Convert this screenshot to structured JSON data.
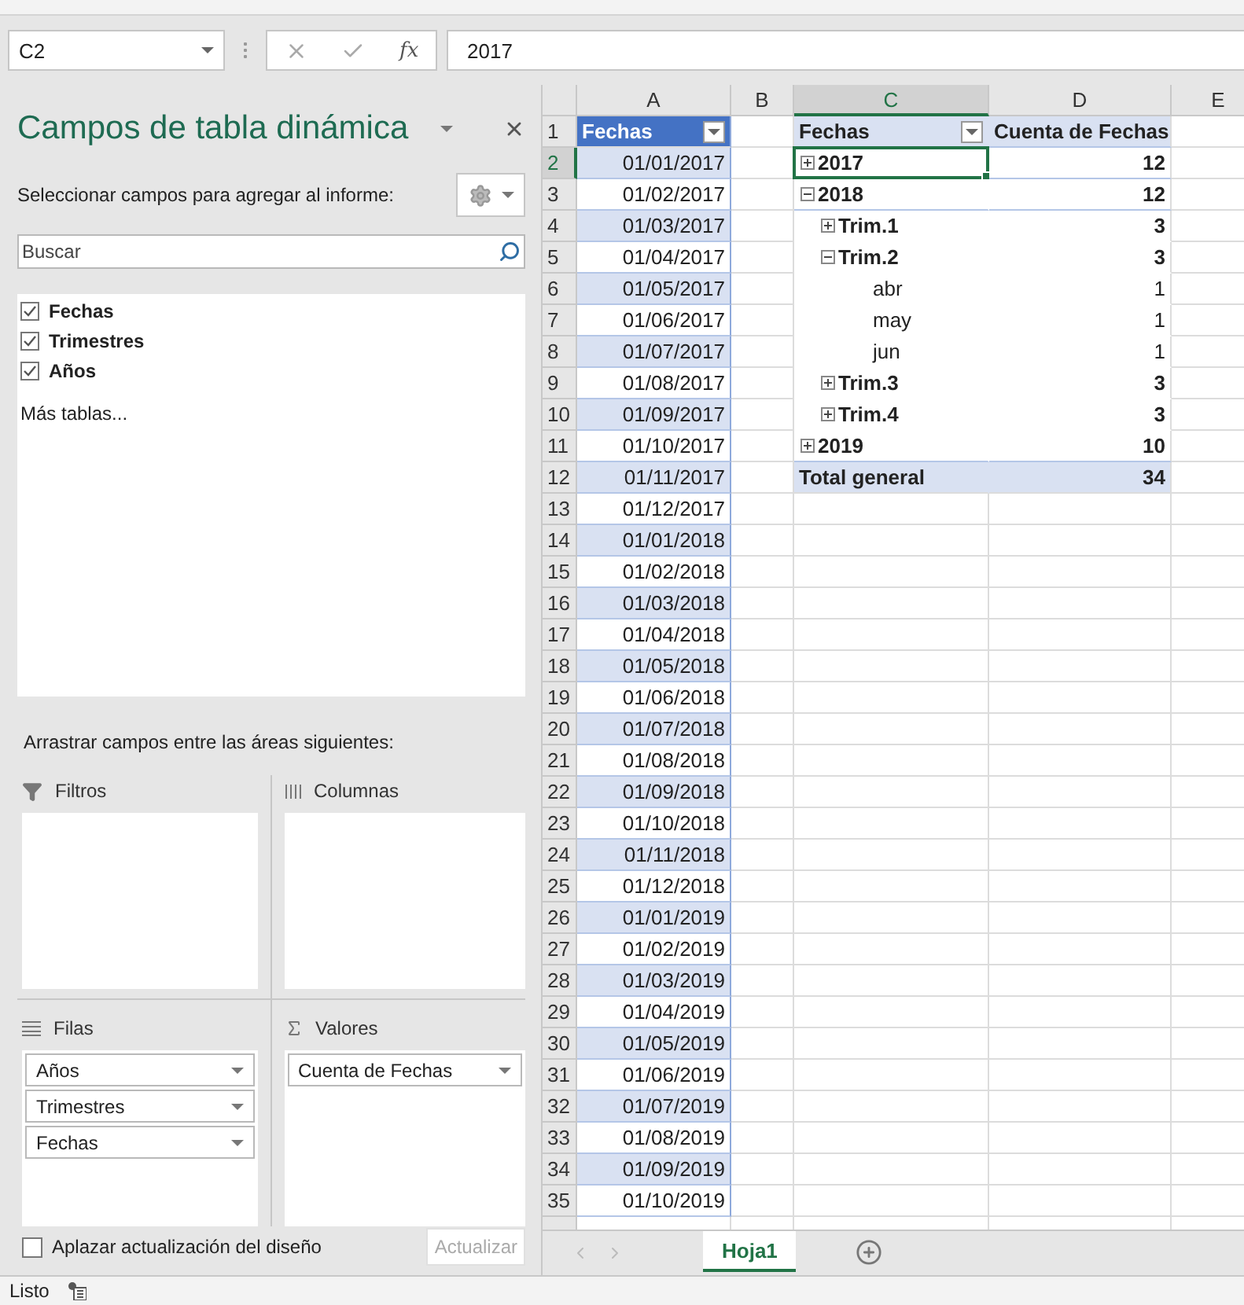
{
  "formula_bar": {
    "name_box": "C2",
    "function_label": "fx",
    "value": "2017"
  },
  "pivot_pane": {
    "title": "Campos de tabla dinámica",
    "subtitle": "Seleccionar campos para agregar al informe:",
    "search": {
      "placeholder": "Buscar"
    },
    "fields": [
      {
        "label": "Fechas",
        "checked": true
      },
      {
        "label": "Trimestres",
        "checked": true
      },
      {
        "label": "Años",
        "checked": true
      }
    ],
    "more_tables": "Más tablas...",
    "areas_label": "Arrastrar campos entre las áreas siguientes:",
    "areas": [
      {
        "name": "Filtros",
        "kind": "filter"
      },
      {
        "name": "Columnas",
        "kind": "columns"
      },
      {
        "name": "Filas",
        "kind": "rows",
        "items": [
          "Años",
          "Trimestres",
          "Fechas"
        ]
      },
      {
        "name": "Valores",
        "kind": "values",
        "items": [
          "Cuenta de Fechas"
        ]
      }
    ],
    "defer": {
      "label": "Aplazar actualización del diseño",
      "checked": false
    },
    "update_button": "Actualizar"
  },
  "sheet": {
    "columns": [
      {
        "label": "A",
        "selected": false
      },
      {
        "label": "B",
        "selected": false
      },
      {
        "label": "C",
        "selected": true
      },
      {
        "label": "D",
        "selected": false
      },
      {
        "label": "E",
        "selected": false
      }
    ],
    "row_numbers": [
      {
        "label": "1",
        "selected": false
      },
      {
        "label": "2",
        "selected": true
      },
      {
        "label": "3",
        "selected": false
      },
      {
        "label": "4",
        "selected": false
      },
      {
        "label": "5",
        "selected": false
      },
      {
        "label": "6",
        "selected": false
      },
      {
        "label": "7",
        "selected": false
      },
      {
        "label": "8",
        "selected": false
      },
      {
        "label": "9",
        "selected": false
      },
      {
        "label": "10",
        "selected": false
      },
      {
        "label": "11",
        "selected": false
      },
      {
        "label": "12",
        "selected": false
      },
      {
        "label": "13",
        "selected": false
      },
      {
        "label": "14",
        "selected": false
      },
      {
        "label": "15",
        "selected": false
      },
      {
        "label": "16",
        "selected": false
      },
      {
        "label": "17",
        "selected": false
      },
      {
        "label": "18",
        "selected": false
      },
      {
        "label": "19",
        "selected": false
      },
      {
        "label": "20",
        "selected": false
      },
      {
        "label": "21",
        "selected": false
      },
      {
        "label": "22",
        "selected": false
      },
      {
        "label": "23",
        "selected": false
      },
      {
        "label": "24",
        "selected": false
      },
      {
        "label": "25",
        "selected": false
      },
      {
        "label": "26",
        "selected": false
      },
      {
        "label": "27",
        "selected": false
      },
      {
        "label": "28",
        "selected": false
      },
      {
        "label": "29",
        "selected": false
      },
      {
        "label": "30",
        "selected": false
      },
      {
        "label": "31",
        "selected": false
      },
      {
        "label": "32",
        "selected": false
      },
      {
        "label": "33",
        "selected": false
      },
      {
        "label": "34",
        "selected": false
      },
      {
        "label": "35",
        "selected": false
      }
    ],
    "table": {
      "header": "Fechas",
      "dates": [
        "01/01/2017",
        "01/02/2017",
        "01/03/2017",
        "01/04/2017",
        "01/05/2017",
        "01/06/2017",
        "01/07/2017",
        "01/08/2017",
        "01/09/2017",
        "01/10/2017",
        "01/11/2017",
        "01/12/2017",
        "01/01/2018",
        "01/02/2018",
        "01/03/2018",
        "01/04/2018",
        "01/05/2018",
        "01/06/2018",
        "01/07/2018",
        "01/08/2018",
        "01/09/2018",
        "01/10/2018",
        "01/11/2018",
        "01/12/2018",
        "01/01/2019",
        "01/02/2019",
        "01/03/2019",
        "01/04/2019",
        "01/05/2019",
        "01/06/2019",
        "01/07/2019",
        "01/08/2019",
        "01/09/2019",
        "01/10/2019"
      ]
    },
    "pivot": {
      "headers": [
        "Fechas",
        "Cuenta de Fechas"
      ],
      "rows": [
        {
          "label": "2017",
          "value": "12",
          "kind": "group",
          "expanded": false,
          "selected": true
        },
        {
          "label": "2018",
          "value": "12",
          "kind": "group",
          "expanded": true,
          "selected": false,
          "children": [
            {
              "label": "Trim.1",
              "value": "3",
              "kind": "group",
              "expanded": false,
              "selected": false
            },
            {
              "label": "Trim.2",
              "value": "3",
              "kind": "group",
              "expanded": true,
              "selected": false,
              "children": [
                {
                  "label": "abr",
                  "value": "1",
                  "kind": "item",
                  "selected": false
                },
                {
                  "label": "may",
                  "value": "1",
                  "kind": "item",
                  "selected": false
                },
                {
                  "label": "jun",
                  "value": "1",
                  "kind": "item",
                  "selected": false
                }
              ]
            },
            {
              "label": "Trim.3",
              "value": "3",
              "kind": "group",
              "expanded": false,
              "selected": false
            },
            {
              "label": "Trim.4",
              "value": "3",
              "kind": "group",
              "expanded": false,
              "selected": false
            }
          ]
        },
        {
          "label": "2019",
          "value": "10",
          "kind": "group",
          "expanded": false,
          "selected": false
        }
      ],
      "total": {
        "label": "Total general",
        "value": "34"
      }
    }
  },
  "sheet_tabs": [
    {
      "label": "Hoja1",
      "selected": true
    }
  ],
  "status_bar": {
    "text": "Listo"
  }
}
